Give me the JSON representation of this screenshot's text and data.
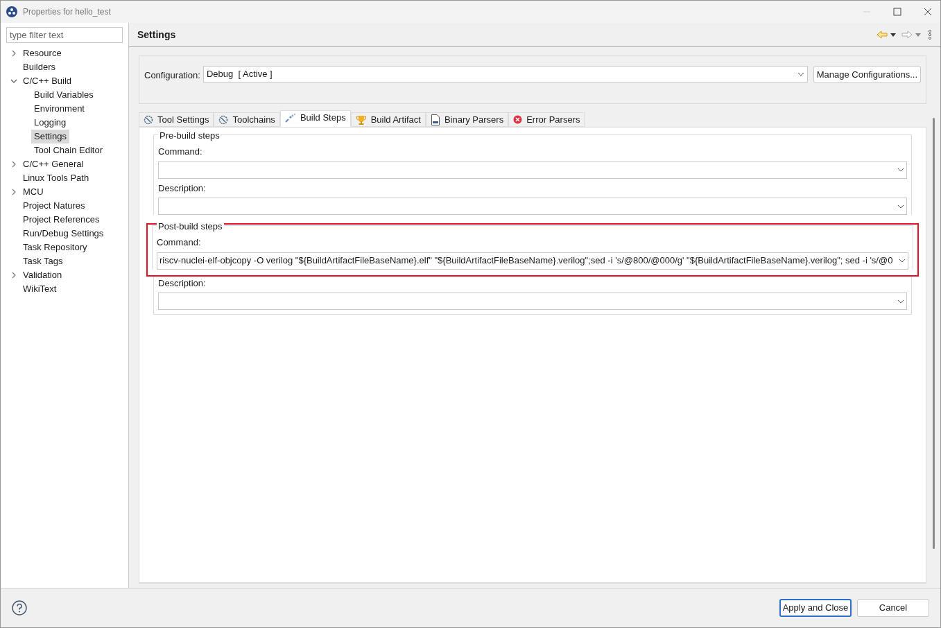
{
  "window": {
    "title": "Properties for hello_test"
  },
  "filter": {
    "placeholder": "type filter text"
  },
  "tree": [
    {
      "label": "Resource",
      "kind": "branch",
      "expanded": false,
      "selected": false
    },
    {
      "label": "Builders",
      "kind": "leaf",
      "selected": false
    },
    {
      "label": "C/C++ Build",
      "kind": "branch",
      "expanded": true,
      "selected": false,
      "children": [
        {
          "label": "Build Variables",
          "kind": "leaf",
          "selected": false
        },
        {
          "label": "Environment",
          "kind": "leaf",
          "selected": false
        },
        {
          "label": "Logging",
          "kind": "leaf",
          "selected": false
        },
        {
          "label": "Settings",
          "kind": "leaf",
          "selected": true
        },
        {
          "label": "Tool Chain Editor",
          "kind": "leaf",
          "selected": false
        }
      ]
    },
    {
      "label": "C/C++ General",
      "kind": "branch",
      "expanded": false,
      "selected": false
    },
    {
      "label": "Linux Tools Path",
      "kind": "leaf",
      "selected": false
    },
    {
      "label": "MCU",
      "kind": "branch",
      "expanded": false,
      "selected": false
    },
    {
      "label": "Project Natures",
      "kind": "leaf",
      "selected": false
    },
    {
      "label": "Project References",
      "kind": "leaf",
      "selected": false
    },
    {
      "label": "Run/Debug Settings",
      "kind": "leaf",
      "selected": false
    },
    {
      "label": "Task Repository",
      "kind": "leaf",
      "selected": false
    },
    {
      "label": "Task Tags",
      "kind": "leaf",
      "selected": false
    },
    {
      "label": "Validation",
      "kind": "branch",
      "expanded": false,
      "selected": false
    },
    {
      "label": "WikiText",
      "kind": "leaf",
      "selected": false
    }
  ],
  "page": {
    "title": "Settings"
  },
  "configuration": {
    "label": "Configuration:",
    "value": "Debug  [ Active ]",
    "button": "Manage Configurations..."
  },
  "tabs": [
    {
      "label": "Tool Settings",
      "kind": "gear",
      "selected": false
    },
    {
      "label": "Toolchains",
      "kind": "gear",
      "selected": false
    },
    {
      "label": "Build Steps",
      "kind": "steps",
      "selected": true
    },
    {
      "label": "Build Artifact",
      "kind": "trophy",
      "selected": false
    },
    {
      "label": "Binary Parsers",
      "kind": "binary",
      "selected": false
    },
    {
      "label": "Error Parsers",
      "kind": "error",
      "selected": false
    }
  ],
  "groups": [
    {
      "title": "Pre-build steps",
      "highlighted": false,
      "fields": [
        {
          "label": "Command:"
        },
        {
          "label": "Description:"
        }
      ]
    },
    {
      "title": "Post-build steps",
      "highlighted": true,
      "fields": [
        {
          "label": "Command:",
          "value": "riscv-nuclei-elf-objcopy -O verilog \"${BuildArtifactFileBaseName}.elf\" \"${BuildArtifactFileBaseName}.verilog\";sed -i 's/@800/@000/g' \"${BuildArtifactFileBaseName}.verilog\"; sed -i 's/@0"
        },
        {
          "label": "Description:"
        }
      ]
    }
  ],
  "footer": {
    "buttons": [
      "Apply and Close",
      "Cancel"
    ]
  }
}
